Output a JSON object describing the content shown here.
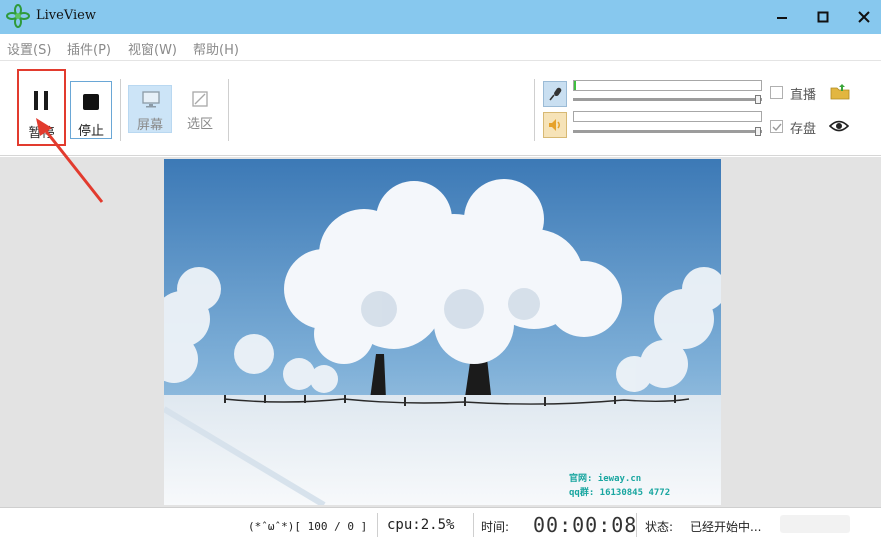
{
  "window": {
    "title": "LiveView"
  },
  "menu": [
    "设置(S)",
    "插件(P)",
    "视窗(W)",
    "帮助(H)"
  ],
  "toolbar": {
    "pause_label": "暂停",
    "stop_label": "停止",
    "screen_label": "屏幕",
    "region_label": "选区"
  },
  "audio": {
    "mic_level": 0.01,
    "speaker_level": 0.0,
    "mic_volume": 0.98,
    "speaker_volume": 0.98
  },
  "options": {
    "live_label": "直播",
    "live_checked": false,
    "save_label": "存盘",
    "save_checked": true
  },
  "preview": {
    "watermark_line1": "官网: ieway.cn",
    "watermark_line2": "qq群: 16130845 4772"
  },
  "status": {
    "face": "(*ˆωˆ*)[ 100 / 0 ]",
    "cpu": "cpu:2.5%",
    "time_label": "时间:",
    "time": "00:00:08",
    "state_label": "状态:",
    "state": "已经开始中..."
  },
  "colors": {
    "titlebar": "#87c8ee",
    "highlight_box": "#e23b2e",
    "accent": "#6aa7d6"
  }
}
